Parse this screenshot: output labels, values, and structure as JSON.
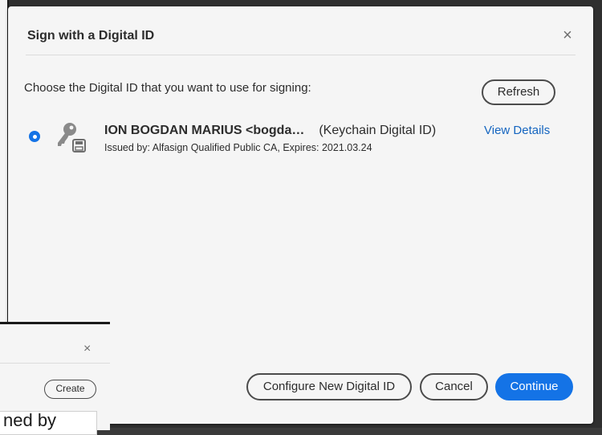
{
  "dialog": {
    "title": "Sign with a Digital ID",
    "close_glyph": "×",
    "prompt": "Choose the Digital ID that you want to use for signing:",
    "refresh_label": "Refresh",
    "digital_id": {
      "name": "ION BOGDAN MARIUS <bogda…",
      "type": "(Keychain Digital ID)",
      "issued": "Issued by: Alfasign Qualified Public CA, Expires: 2021.03.24",
      "view_details": "View Details",
      "icon": "key-card-icon",
      "selected": true
    },
    "buttons": {
      "configure": "Configure New Digital ID",
      "cancel": "Cancel",
      "continue": "Continue"
    }
  },
  "background_dialog": {
    "close_glyph": "×",
    "create_label": "Create",
    "field_text": "ned by"
  },
  "colors": {
    "accent": "#1473e6",
    "link": "#1565c0",
    "dialog_bg": "#f5f5f5"
  }
}
